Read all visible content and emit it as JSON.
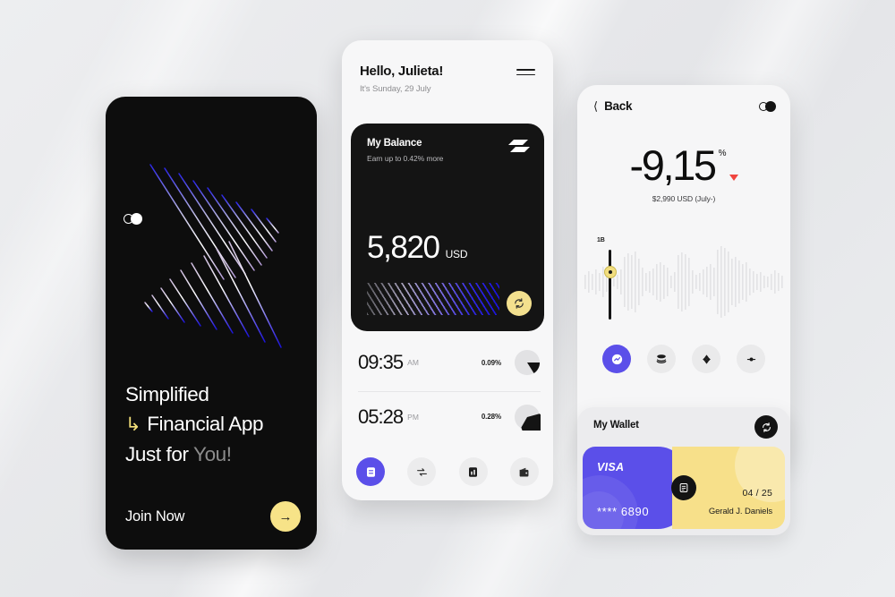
{
  "background": {
    "color": "#e9eaec"
  },
  "theme": {
    "accent_purple": "#5b4fe9",
    "accent_yellow": "#f7e08a",
    "dark": "#141414",
    "danger_red": "#f0453f"
  },
  "onboarding": {
    "logo_icon": "two-circles-logo-icon",
    "artwork_icon": "diagonal-lines-artwork",
    "headline_line1": "Simplified",
    "headline_line2": "Financial App",
    "headline_line3_strong": "Just for ",
    "headline_line3_muted": "You!",
    "hook_icon": "arrow-hook-icon",
    "cta_label": "Join Now",
    "cta_arrow_icon": "arrow-right-icon"
  },
  "home": {
    "greeting": "Hello, Julieta!",
    "date": "It's Sunday, 29 July",
    "menu_icon": "hamburger-menu-icon",
    "balance_card": {
      "title": "My Balance",
      "subtitle": "Earn up to 0.42% more",
      "brand_icon": "slant-bars-logo-icon",
      "amount": "5,820",
      "currency": "USD",
      "refresh_icon": "refresh-icon"
    },
    "rates": [
      {
        "time": "09:35",
        "meridiem": "AM",
        "percent": "0.09%",
        "chart_icon": "pie-chart-icon"
      },
      {
        "time": "05:28",
        "meridiem": "PM",
        "percent": "0.28%",
        "chart_icon": "pie-chart-icon"
      }
    ],
    "nav": [
      {
        "icon": "cards-icon",
        "active": true
      },
      {
        "icon": "exchange-icon",
        "active": false
      },
      {
        "icon": "stats-icon",
        "active": false
      },
      {
        "icon": "wallet-icon",
        "active": false
      }
    ]
  },
  "detail": {
    "back_label": "Back",
    "back_icon": "chevron-left-icon",
    "logo_icon": "two-circles-logo-icon",
    "change_value": "-9,15",
    "change_unit": "%",
    "trend_icon": "triangle-down-icon",
    "summary": "$2,990 USD (July-)",
    "waveform_icon": "audio-waveform-icon",
    "cursor_icon": "playhead-cursor-icon",
    "cursor_tag": "1B",
    "actions": [
      {
        "icon": "trend-up-icon",
        "active": true
      },
      {
        "icon": "layers-stack-icon",
        "active": false
      },
      {
        "icon": "diamond-icon",
        "active": false
      },
      {
        "icon": "pin-icon",
        "active": false
      }
    ]
  },
  "wallet": {
    "title": "My Wallet",
    "refresh_icon": "refresh-icon",
    "chip_icon": "card-chip-icon",
    "card": {
      "brand": "VISA",
      "number": "**** 6890",
      "expiry": "04 / 25",
      "holder": "Gerald J. Daniels"
    }
  }
}
